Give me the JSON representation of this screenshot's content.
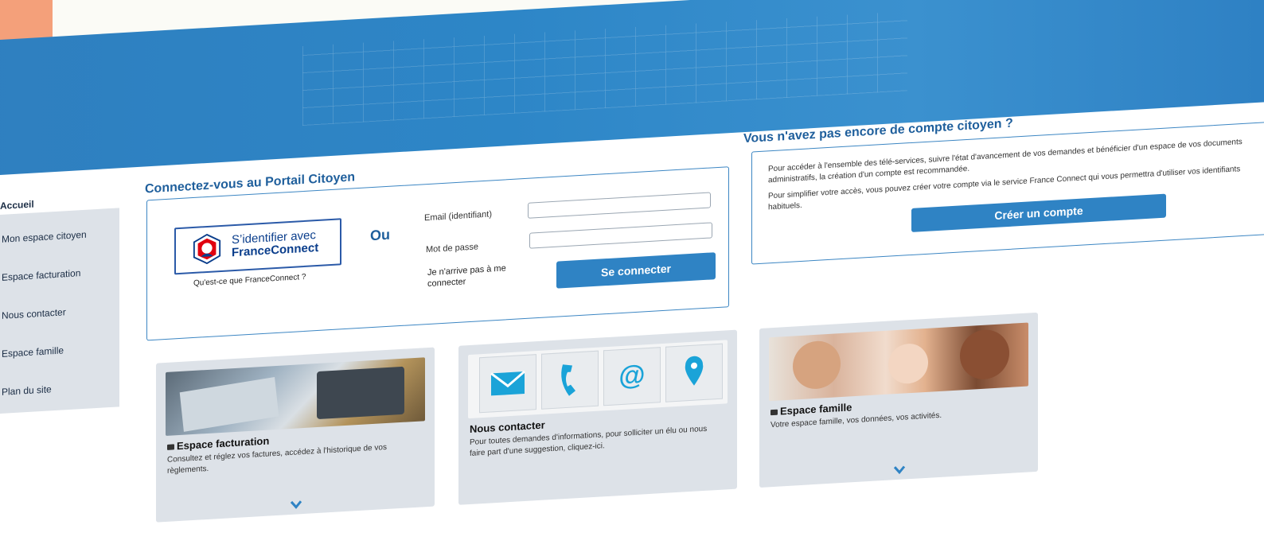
{
  "sidebar": {
    "items": [
      {
        "label": "Accueil"
      },
      {
        "label": "Mon espace citoyen"
      },
      {
        "label": "Espace facturation"
      },
      {
        "label": "Nous contacter"
      },
      {
        "label": "Espace famille"
      },
      {
        "label": "Plan du site"
      }
    ]
  },
  "login": {
    "title": "Connectez-vous au Portail Citoyen",
    "franceconnect_line1": "S’identifier avec",
    "franceconnect_line2": "FranceConnect",
    "franceconnect_help": "Qu'est-ce que FranceConnect ?",
    "or_label": "Ou",
    "email_label": "Email (identifiant)",
    "password_label": "Mot de passe",
    "email_value": "",
    "password_value": "",
    "forgot_label": "Je n'arrive pas à me connecter",
    "submit_label": "Se connecter"
  },
  "signup": {
    "title": "Vous n'avez pas encore de compte citoyen ?",
    "paragraph1": "Pour accéder à l'ensemble des télé-services, suivre l'état d'avancement de vos demandes et bénéficier d'un espace de vos documents administratifs, la création d'un compte est recommandée.",
    "paragraph2": "Pour simplifier votre accès, vous pouvez créer votre compte via le service France Connect qui vous permettra d'utiliser vos identifiants habituels.",
    "button_label": "Créer un compte"
  },
  "cards": [
    {
      "title": "Espace facturation",
      "description": "Consultez et réglez vos factures, accédez à l'historique de vos règlements.",
      "locked": true
    },
    {
      "title": "Nous contacter",
      "description": "Pour toutes demandes d'informations, pour solliciter un élu ou nous faire part d'une suggestion, cliquez-ici.",
      "locked": false
    },
    {
      "title": "Espace famille",
      "description": "Votre espace famille, vos données, vos activités.",
      "locked": true
    }
  ],
  "colors": {
    "brand_blue": "#2f83c4",
    "title_blue": "#1f5f9c",
    "card_bg": "#dde2e8",
    "accent_orange": "#f4a07a"
  },
  "icons": [
    "envelope-icon",
    "phone-icon",
    "at-icon",
    "location-pin-icon",
    "lock-icon",
    "chevron-down-icon"
  ]
}
